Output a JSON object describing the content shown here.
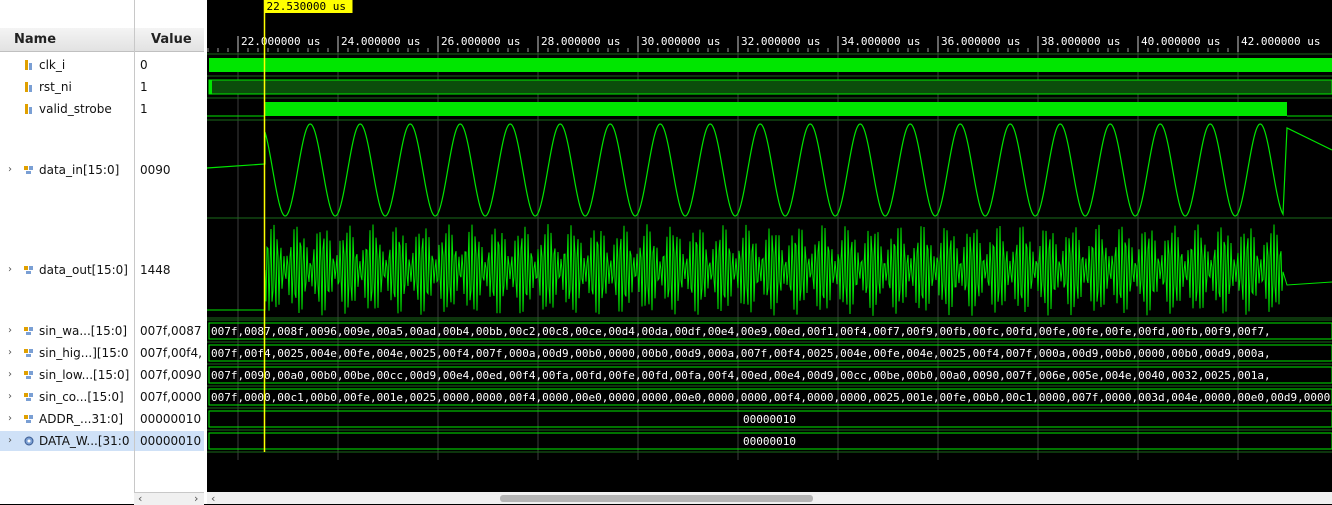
{
  "headers": {
    "name": "Name",
    "value": "Value"
  },
  "cursor": {
    "label": "22.530000 us",
    "time_us": 22.53
  },
  "timeline": {
    "ticks": [
      "22.000000 us",
      "24.000000 us",
      "26.000000 us",
      "28.000000 us",
      "30.000000 us",
      "32.000000 us",
      "34.000000 us",
      "36.000000 us",
      "38.000000 us",
      "40.000000 us",
      "42.000000 us"
    ]
  },
  "signals": [
    {
      "name": "clk_i",
      "value": "0",
      "type": "bit",
      "expandable": false
    },
    {
      "name": "rst_ni",
      "value": "1",
      "type": "bit",
      "expandable": false
    },
    {
      "name": "valid_strobe",
      "value": "1",
      "type": "bit",
      "expandable": false
    },
    {
      "name": "data_in[15:0]",
      "value": "0090",
      "type": "bus",
      "expandable": true
    },
    {
      "name": "data_out[15:0]",
      "value": "1448",
      "type": "bus",
      "expandable": true
    },
    {
      "name": "sin_wa...[15:0]",
      "value": "007f,0087",
      "type": "bus",
      "expandable": true,
      "trace": "007f,0087,008f,0096,009e,00a5,00ad,00b4,00bb,00c2,00c8,00ce,00d4,00da,00df,00e4,00e9,00ed,00f1,00f4,00f7,00f9,00fb,00fc,00fd,00fe,00fe,00fe,00fd,00fb,00f9,00f7,"
    },
    {
      "name": "sin_hig...][15:0",
      "value": "007f,00f4,",
      "type": "bus",
      "expandable": true,
      "trace": "007f,00f4,0025,004e,00fe,004e,0025,00f4,007f,000a,00d9,00b0,0000,00b0,00d9,000a,007f,00f4,0025,004e,00fe,004e,0025,00f4,007f,000a,00d9,00b0,0000,00b0,00d9,000a,"
    },
    {
      "name": "sin_low...[15:0]",
      "value": "007f,0090",
      "type": "bus",
      "expandable": true,
      "trace": "007f,0090,00a0,00b0,00be,00cc,00d9,00e4,00ed,00f4,00fa,00fd,00fe,00fd,00fa,00f4,00ed,00e4,00d9,00cc,00be,00b0,00a0,0090,007f,006e,005e,004e,0040,0032,0025,001a,"
    },
    {
      "name": "sin_co...[15:0]",
      "value": "007f,0000",
      "type": "bus",
      "expandable": true,
      "trace": "007f,0000,00c1,00b0,00fe,001e,0025,0000,0000,00f4,0000,00e0,0000,0000,00e0,0000,0000,00f4,0000,0000,0025,001e,00fe,00b0,00c1,0000,007f,0000,003d,004e,0000,00e0,00d9,0000,"
    },
    {
      "name": "ADDR_...31:0]",
      "value": "00000010",
      "type": "bus",
      "expandable": true,
      "trace": "00000010"
    },
    {
      "name": "DATA_W...[31:0",
      "value": "00000010",
      "type": "bus",
      "expandable": true,
      "trace": "00000010"
    }
  ],
  "colors": {
    "wave": "#00e600",
    "bus_dark": "#0b4d0b",
    "cursor": "#ffff00",
    "grid": "#3c3c3c",
    "bg": "#000000",
    "text": "#ffffff"
  }
}
